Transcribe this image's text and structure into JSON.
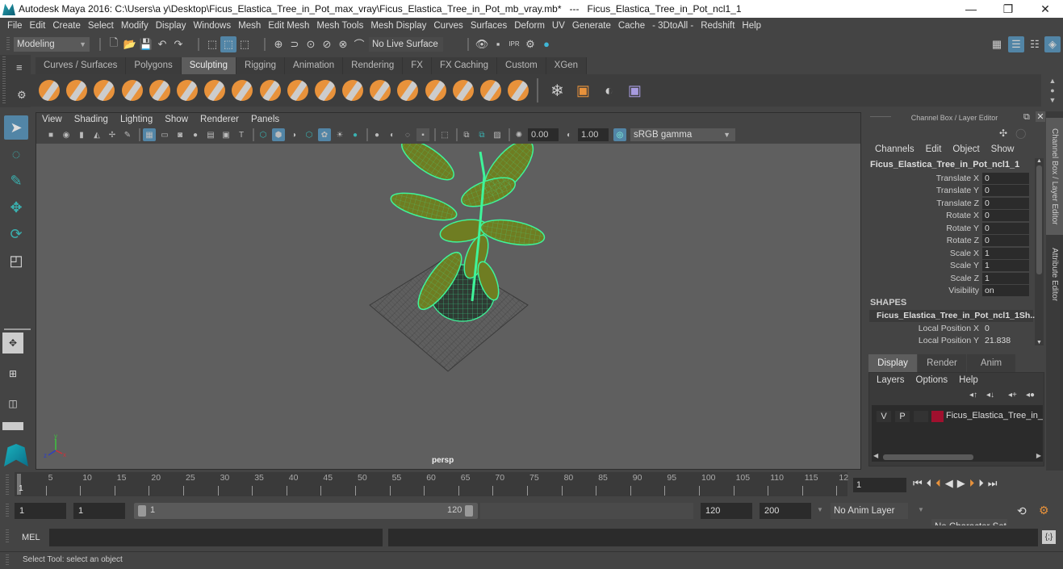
{
  "window": {
    "title": "Autodesk Maya 2016: C:\\Users\\a y\\Desktop\\Ficus_Elastica_Tree_in_Pot_max_vray\\Ficus_Elastica_Tree_in_Pot_mb_vray.mb*   ---   Ficus_Elastica_Tree_in_Pot_ncl1_1",
    "minimize": "—",
    "restore": "❐",
    "close": "✕"
  },
  "menubar": [
    "File",
    "Edit",
    "Create",
    "Select",
    "Modify",
    "Display",
    "Windows",
    "Mesh",
    "Edit Mesh",
    "Mesh Tools",
    "Mesh Display",
    "Curves",
    "Surfaces",
    "Deform",
    "UV",
    "Generate",
    "Cache",
    "- 3DtoAll -",
    "Redshift",
    "Help"
  ],
  "statusline": {
    "mode": "Modeling",
    "live_surface": "No Live Surface"
  },
  "shelf": {
    "tabs": [
      "Curves / Surfaces",
      "Polygons",
      "Sculpting",
      "Rigging",
      "Animation",
      "Rendering",
      "FX",
      "FX Caching",
      "Custom",
      "XGen"
    ],
    "active_tab": "Sculpting",
    "tools": [
      "sculpt",
      "smooth",
      "relax",
      "grab",
      "pinch",
      "flatten",
      "foamy",
      "spray",
      "repeat",
      "imprint",
      "wax",
      "scrape",
      "fill",
      "knife",
      "smear",
      "bulge",
      "amplify",
      "freeze"
    ]
  },
  "viewport": {
    "menu": [
      "View",
      "Shading",
      "Lighting",
      "Show",
      "Renderer",
      "Panels"
    ],
    "exposure": "0.00",
    "gamma": "1.00",
    "color_space": "sRGB gamma",
    "camera_label": "persp",
    "axis": {
      "x": "x",
      "y": "y",
      "z": "z"
    }
  },
  "channel_box": {
    "title": "Channel Box / Layer Editor",
    "menu": [
      "Channels",
      "Edit",
      "Object",
      "Show"
    ],
    "object_name": "Ficus_Elastica_Tree_in_Pot_ncl1_1",
    "channels": [
      {
        "label": "Translate X",
        "value": "0"
      },
      {
        "label": "Translate Y",
        "value": "0"
      },
      {
        "label": "Translate Z",
        "value": "0"
      },
      {
        "label": "Rotate X",
        "value": "0"
      },
      {
        "label": "Rotate Y",
        "value": "0"
      },
      {
        "label": "Rotate Z",
        "value": "0"
      },
      {
        "label": "Scale X",
        "value": "1"
      },
      {
        "label": "Scale Y",
        "value": "1"
      },
      {
        "label": "Scale Z",
        "value": "1"
      },
      {
        "label": "Visibility",
        "value": "on"
      }
    ],
    "shapes_header": "SHAPES",
    "shape_name": "Ficus_Elastica_Tree_in_Pot_ncl1_1Sh...",
    "shape_channels": [
      {
        "label": "Local Position X",
        "value": "0"
      },
      {
        "label": "Local Position Y",
        "value": "21.838"
      }
    ]
  },
  "side_tabs": [
    "Channel Box / Layer Editor",
    "Attribute Editor"
  ],
  "layer_editor": {
    "tabs": [
      "Display",
      "Render",
      "Anim"
    ],
    "active_tab": "Display",
    "menu": [
      "Layers",
      "Options",
      "Help"
    ],
    "layers": [
      {
        "v": "V",
        "p": "P",
        "color": "#a0102e",
        "name": "Ficus_Elastica_Tree_in_Pc"
      }
    ]
  },
  "timeline": {
    "ticks": [
      "5",
      "10",
      "15",
      "20",
      "25",
      "30",
      "35",
      "40",
      "45",
      "50",
      "55",
      "60",
      "65",
      "70",
      "75",
      "80",
      "85",
      "90",
      "95",
      "100",
      "105",
      "110",
      "115",
      "12"
    ],
    "current_marker": "1",
    "current_frame": "1"
  },
  "range": {
    "start": "1",
    "playback_start": "1",
    "slider_start": "1",
    "slider_end": "120",
    "playback_end": "120",
    "end": "200",
    "anim_layer": "No Anim Layer",
    "character_set": "No Character Set"
  },
  "command": {
    "label": "MEL"
  },
  "status": {
    "help_text": "Select Tool: select an object"
  }
}
